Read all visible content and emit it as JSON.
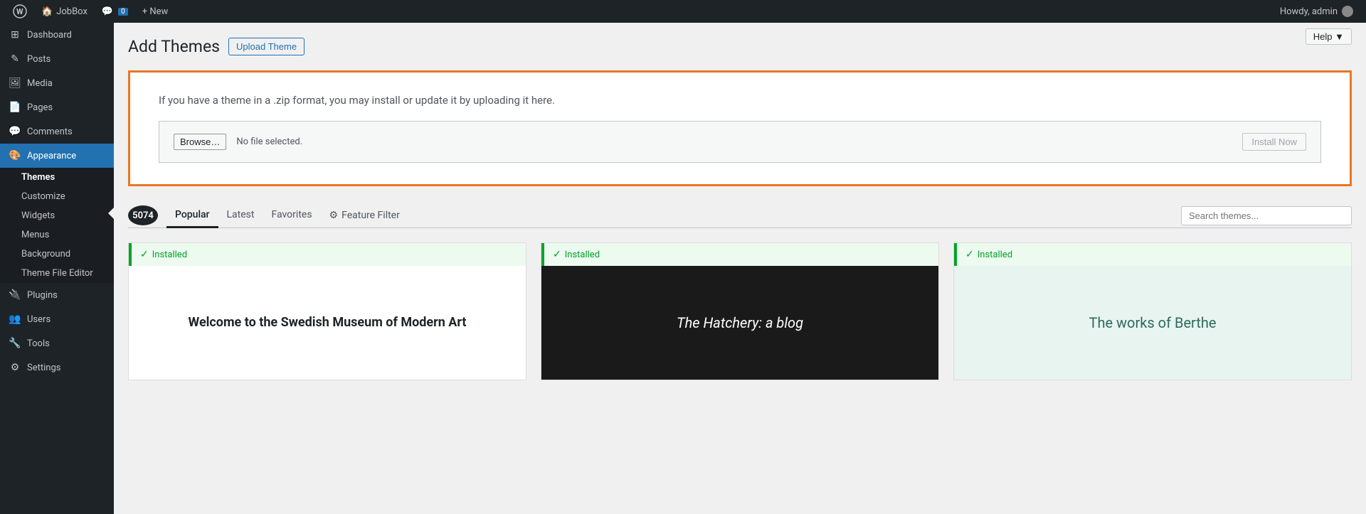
{
  "adminbar": {
    "site_name": "JobBox",
    "new_label": "+ New",
    "comment_count": "0",
    "howdy": "Howdy, admin"
  },
  "sidebar": {
    "items": [
      {
        "id": "dashboard",
        "label": "Dashboard",
        "icon": "⊞"
      },
      {
        "id": "posts",
        "label": "Posts",
        "icon": "✎"
      },
      {
        "id": "media",
        "label": "Media",
        "icon": "🖼"
      },
      {
        "id": "pages",
        "label": "Pages",
        "icon": "📄"
      },
      {
        "id": "comments",
        "label": "Comments",
        "icon": "💬"
      },
      {
        "id": "appearance",
        "label": "Appearance",
        "icon": "🎨",
        "active": true
      }
    ],
    "appearance_submenu": [
      {
        "id": "themes",
        "label": "Themes",
        "active": true
      },
      {
        "id": "customize",
        "label": "Customize"
      },
      {
        "id": "widgets",
        "label": "Widgets"
      },
      {
        "id": "menus",
        "label": "Menus"
      },
      {
        "id": "background",
        "label": "Background"
      },
      {
        "id": "theme-file-editor",
        "label": "Theme File Editor"
      }
    ],
    "items_after": [
      {
        "id": "plugins",
        "label": "Plugins",
        "icon": "🔌"
      },
      {
        "id": "users",
        "label": "Users",
        "icon": "👥"
      },
      {
        "id": "tools",
        "label": "Tools",
        "icon": "🔧"
      },
      {
        "id": "settings",
        "label": "Settings",
        "icon": "⚙"
      }
    ]
  },
  "page": {
    "title": "Add Themes",
    "upload_theme_btn": "Upload Theme",
    "help_btn": "Help ▼"
  },
  "upload_box": {
    "description": "If you have a theme in a .zip format, you may install or update it by uploading it here.",
    "browse_btn": "Browse…",
    "no_file": "No file selected.",
    "install_btn": "Install Now"
  },
  "tabs": {
    "count": "5074",
    "items": [
      {
        "id": "popular",
        "label": "Popular",
        "active": true
      },
      {
        "id": "latest",
        "label": "Latest"
      },
      {
        "id": "favorites",
        "label": "Favorites"
      }
    ],
    "feature_filter": "Feature Filter",
    "search_placeholder": "Search themes..."
  },
  "theme_cards": [
    {
      "installed": true,
      "installed_label": "Installed",
      "preview_text": "Welcome to the Swedish Museum of Modern Art",
      "preview_style": "light"
    },
    {
      "installed": true,
      "installed_label": "Installed",
      "preview_text": "The Hatchery: a blog",
      "preview_style": "dark"
    },
    {
      "installed": true,
      "installed_label": "Installed",
      "preview_text": "The works of Berthe",
      "preview_style": "mint"
    }
  ]
}
